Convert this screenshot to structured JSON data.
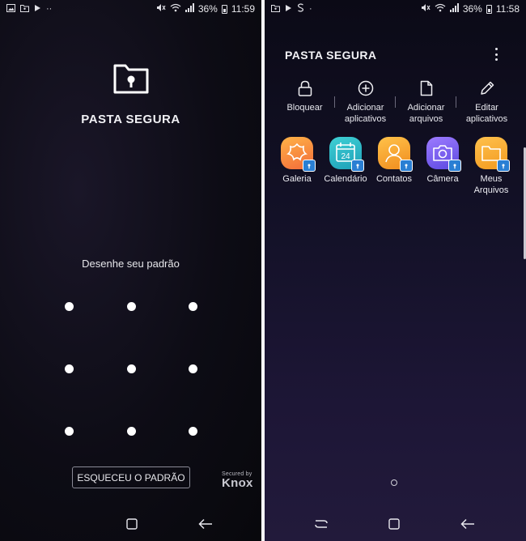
{
  "left": {
    "status": {
      "icons_left": [
        "image-icon",
        "secure-folder-icon",
        "play-icon",
        "more-notifications-icon"
      ],
      "icons_right": [
        "mute-icon",
        "wifi-icon",
        "signal-icon"
      ],
      "battery": "36%",
      "time": "11:59"
    },
    "title": "PASTA SEGURA",
    "pattern_prompt": "Desenhe seu padrão",
    "forgot_button": "ESQUECEU O PADRÃO",
    "knox_small": "Secured by",
    "knox_brand": "Knox",
    "nav": [
      "recents-icon",
      "back-icon"
    ]
  },
  "right": {
    "status": {
      "icons_left": [
        "secure-folder-icon",
        "play-icon",
        "s-icon",
        "notification-dot-icon"
      ],
      "icons_right": [
        "mute-icon",
        "wifi-icon",
        "signal-icon"
      ],
      "battery": "36%",
      "time": "11:58"
    },
    "title": "PASTA SEGURA",
    "actions": [
      {
        "label_line1": "Bloquear",
        "label_line2": "",
        "icon": "lock-icon"
      },
      {
        "label_line1": "Adicionar",
        "label_line2": "aplicativos",
        "icon": "plus-circle-icon"
      },
      {
        "label_line1": "Adicionar",
        "label_line2": "arquivos",
        "icon": "file-icon"
      },
      {
        "label_line1": "Editar",
        "label_line2": "aplicativos",
        "icon": "pencil-icon"
      }
    ],
    "apps": [
      {
        "label_line1": "Galeria",
        "label_line2": "",
        "icon": "gallery-icon",
        "color": "#f7933a"
      },
      {
        "label_line1": "Calendário",
        "label_line2": "",
        "icon": "calendar-icon",
        "color": "#26b5c2",
        "calendar_day": "24"
      },
      {
        "label_line1": "Contatos",
        "label_line2": "",
        "icon": "contacts-icon",
        "color": "#f5a623"
      },
      {
        "label_line1": "Câmera",
        "label_line2": "",
        "icon": "camera-icon",
        "color": "#7a5cf0"
      },
      {
        "label_line1": "Meus",
        "label_line2": "Arquivos",
        "icon": "folder-icon",
        "color": "#f5a623"
      }
    ],
    "nav": [
      "recent-apps-icon",
      "home-icon",
      "back-icon"
    ]
  }
}
